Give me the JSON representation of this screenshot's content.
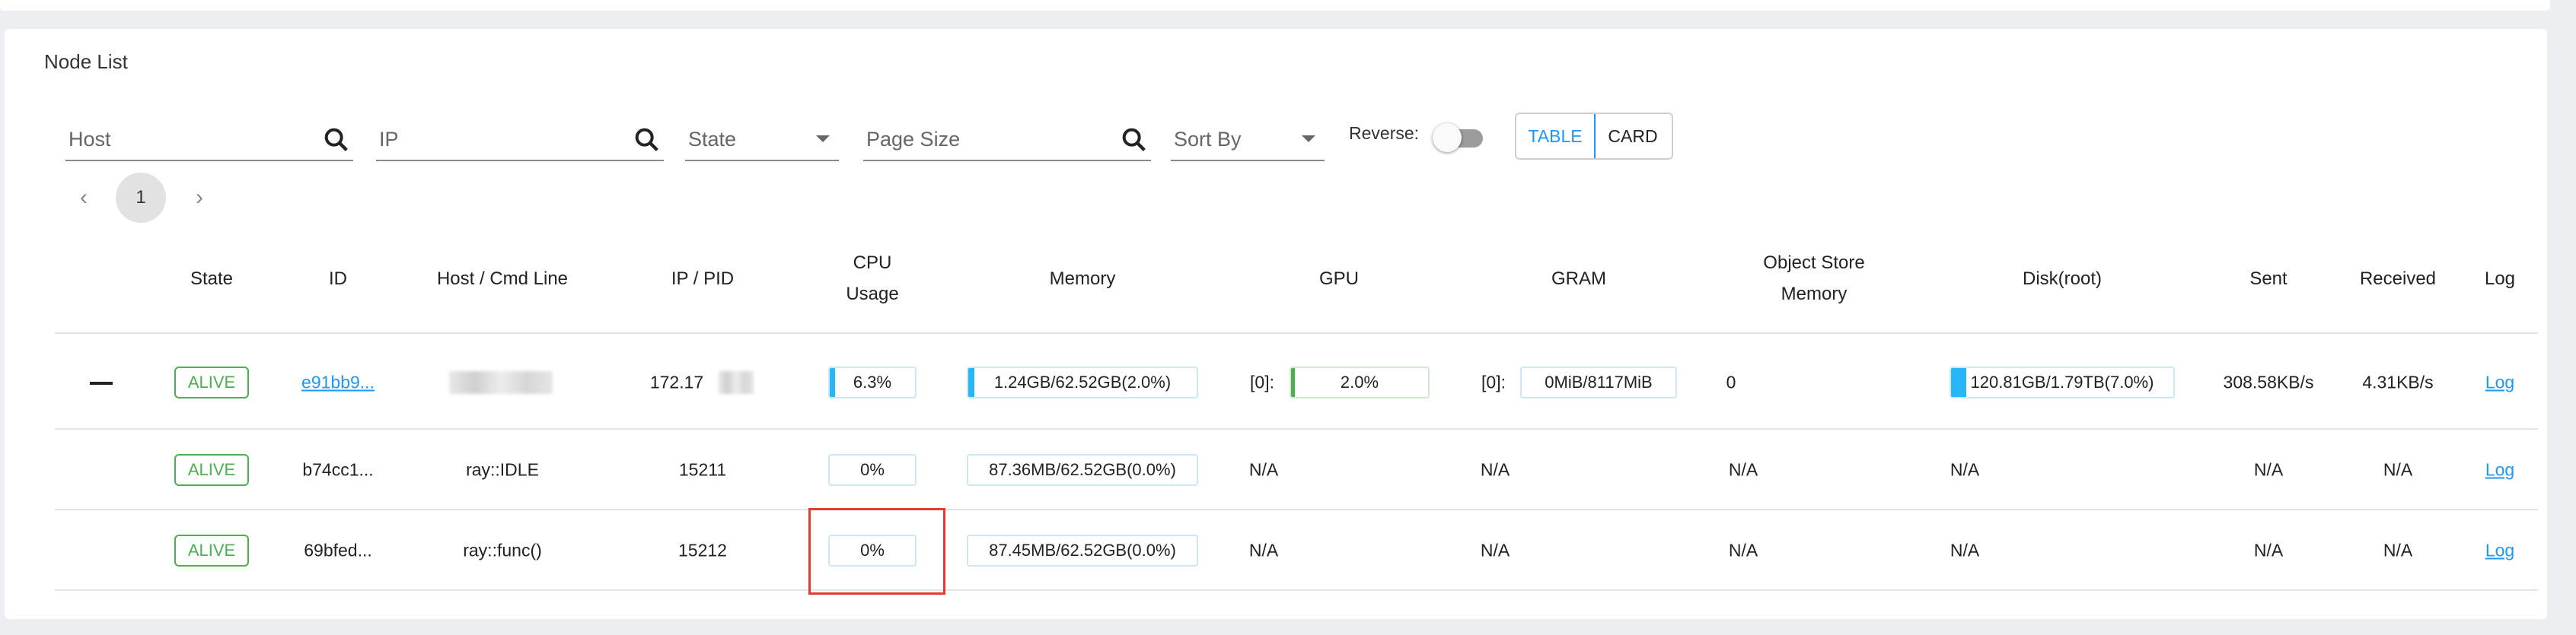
{
  "panel": {
    "title": "Node List"
  },
  "filters": {
    "host_placeholder": "Host",
    "ip_placeholder": "IP",
    "state_placeholder": "State",
    "page_size_placeholder": "Page Size",
    "sort_by_placeholder": "Sort By",
    "reverse_label": "Reverse:",
    "reverse_on": false,
    "view_table": "TABLE",
    "view_card": "CARD",
    "active_view": "TABLE"
  },
  "pagination": {
    "current": "1",
    "prev": "‹",
    "next": "›"
  },
  "table": {
    "headers": {
      "state": "State",
      "id": "ID",
      "host": "Host / Cmd Line",
      "ip": "IP / PID",
      "cpu_1": "CPU",
      "cpu_2": "Usage",
      "memory": "Memory",
      "gpu": "GPU",
      "gram": "GRAM",
      "object_store_1": "Object Store",
      "object_store_2": "Memory",
      "disk": "Disk(root)",
      "sent": "Sent",
      "received": "Received",
      "log": "Log"
    },
    "rows": [
      {
        "state": "ALIVE",
        "id": "e91bb9...",
        "host": "",
        "ip": "172.17",
        "cpu": "6.3%",
        "cpu_fraction": 0.063,
        "memory": "1.24GB/62.52GB(2.0%)",
        "memory_fraction": 0.02,
        "gpu_prefix": "[0]:",
        "gpu": "2.0%",
        "gpu_fraction": 0.02,
        "gram_prefix": "[0]:",
        "gram": "0MiB/8117MiB",
        "object_store": "0",
        "disk": "120.81GB/1.79TB(7.0%)",
        "disk_fraction": 0.07,
        "sent": "308.58KB/s",
        "received": "4.31KB/s",
        "log": "Log"
      },
      {
        "state": "ALIVE",
        "id": "b74cc1...",
        "host": "ray::IDLE",
        "ip": "15211",
        "cpu": "0%",
        "memory": "87.36MB/62.52GB(0.0%)",
        "gpu": "N/A",
        "gram": "N/A",
        "object_store": "N/A",
        "disk": "N/A",
        "sent": "N/A",
        "received": "N/A",
        "log": "Log"
      },
      {
        "state": "ALIVE",
        "id": "69bfed...",
        "host": "ray::func()",
        "ip": "15212",
        "cpu": "0%",
        "memory": "87.45MB/62.52GB(0.0%)",
        "gpu": "N/A",
        "gram": "N/A",
        "object_store": "N/A",
        "disk": "N/A",
        "sent": "N/A",
        "received": "N/A",
        "log": "Log"
      }
    ]
  },
  "colors": {
    "accent": "#2196f3",
    "alive": "#4caf50",
    "bar_fill": "#29b6f6",
    "highlight": "#e53935"
  },
  "icons": {
    "collapse": "minus-icon",
    "search": "search-icon",
    "dropdown": "caret-down-icon"
  }
}
